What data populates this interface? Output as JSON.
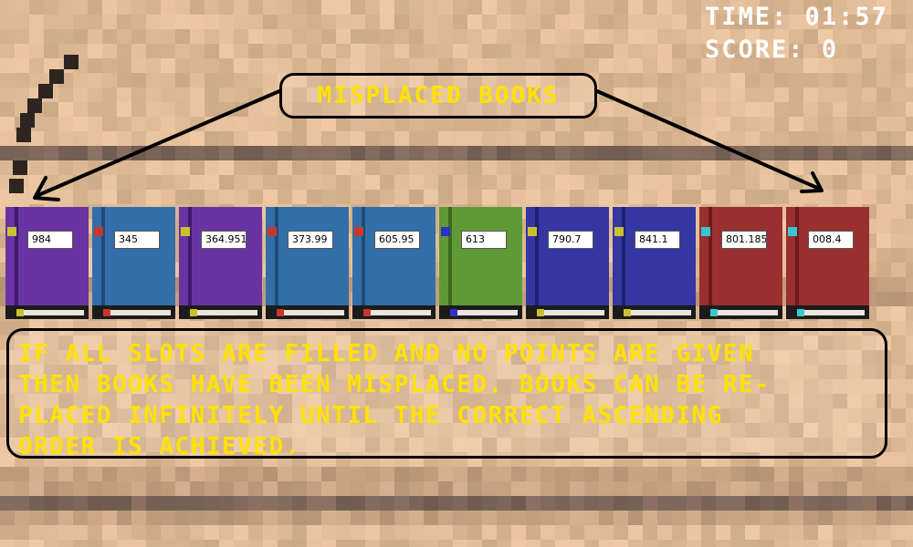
{
  "hud": {
    "time_label": "TIME:",
    "time_value": "01:57",
    "score_label": "SCORE:",
    "score_value": "0"
  },
  "callout": {
    "text": "MISPLACED BOOKS"
  },
  "books": [
    {
      "label": "984",
      "cover": "#6a33a3",
      "spine": "#3f1a6c",
      "ribbon": "#c9c230",
      "mark": "#c9c230"
    },
    {
      "label": "345",
      "cover": "#326fa8",
      "spine": "#1f4a77",
      "ribbon": "#c8372e",
      "mark": "#c8372e"
    },
    {
      "label": "364.951",
      "cover": "#6a33a3",
      "spine": "#3f1a6c",
      "ribbon": "#c9c230",
      "mark": "#c9c230"
    },
    {
      "label": "373.99",
      "cover": "#326fa8",
      "spine": "#1f4a77",
      "ribbon": "#c8372e",
      "mark": "#c8372e"
    },
    {
      "label": "605.95",
      "cover": "#326fa8",
      "spine": "#1f4a77",
      "ribbon": "#c8372e",
      "mark": "#c8372e"
    },
    {
      "label": "613",
      "cover": "#5f9a36",
      "spine": "#3a6a1d",
      "ribbon": "#2c33c4",
      "mark": "#2c33c4"
    },
    {
      "label": "790.7",
      "cover": "#3536a2",
      "spine": "#20216c",
      "ribbon": "#c9c230",
      "mark": "#c9c230"
    },
    {
      "label": "841.1",
      "cover": "#3536a2",
      "spine": "#20216c",
      "ribbon": "#c9c230",
      "mark": "#c9c230"
    },
    {
      "label": "801.185",
      "cover": "#9a2f2f",
      "spine": "#6a1b1b",
      "ribbon": "#38c7cf",
      "mark": "#38c7cf"
    },
    {
      "label": "008.4",
      "cover": "#9a2f2f",
      "spine": "#6a1b1b",
      "ribbon": "#38c7cf",
      "mark": "#38c7cf"
    }
  ],
  "instructions": {
    "line1": "IF ALL SLOTS ARE FILLED AND NO POINTS ARE GIVEN",
    "line2": "THEN BOOKS HAVE BEEN MISPLACED. BOOKS CAN BE RE-",
    "line3": "PLACED INFINITELY UNTIL THE CORRECT ASCENDING",
    "line4": "ORDER IS ACHIEVED."
  },
  "colors": {
    "text_yellow": "#ffe200",
    "hud_white": "#ffffff",
    "wood_light": "#d9b48f",
    "wood_dark": "#6e5a4d"
  }
}
